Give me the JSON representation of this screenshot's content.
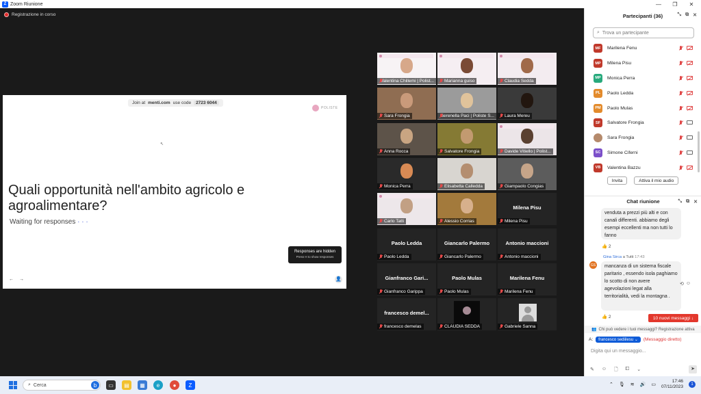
{
  "window": {
    "title": "Zoom Riunione",
    "app_icon": "zoom-logo-icon"
  },
  "recording": {
    "label": "Registrazione in corso"
  },
  "shared_screen": {
    "join_prefix": "Join at",
    "join_site": "menti.com",
    "join_mid": "use code",
    "join_code": "2723 6044",
    "logo_text": "POLISTE",
    "question": "Quali opportunità nell'ambito agricolo e agroalimentare?",
    "status": "Waiting for responses",
    "status_dots": "· · ·",
    "hidden_title": "Responses are hidden",
    "hidden_hint": "Press H to show responses"
  },
  "video_tiles": [
    {
      "name": "Valentina Chillemi | Polist...",
      "type": "video",
      "speaking": true,
      "banner": true,
      "bg": "#f7f3f5",
      "skin": "#d7a88a"
    },
    {
      "name": "Marianna guiso",
      "type": "video",
      "banner": true,
      "bg": "#f5eef2",
      "skin": "#7a4a35"
    },
    {
      "name": "Claudia Sedda",
      "type": "video",
      "banner": true,
      "bg": "#f3ecf0",
      "skin": "#a06a4a"
    },
    {
      "name": "Sara Frongia",
      "type": "video",
      "bg": "#8f6d52",
      "skin": "#c99a7a"
    },
    {
      "name": "Serenella Paci | Poliste S...",
      "type": "video",
      "bg": "#9b9b9b",
      "skin": "#e0c39b"
    },
    {
      "name": "Laura Mereu",
      "type": "video",
      "bg": "#3a3a3a",
      "skin": "#22160f"
    },
    {
      "name": "Anna Rocca",
      "type": "video",
      "bg": "#5d5349",
      "skin": "#c9a582"
    },
    {
      "name": "Salvatore Frongia",
      "type": "video",
      "bg": "#857a34",
      "skin": "#c29a70"
    },
    {
      "name": "Davide Vitiello | Polist...",
      "type": "video",
      "banner": true,
      "bg": "#ece5e8",
      "skin": "#5a4030"
    },
    {
      "name": "Monica Perra",
      "type": "video",
      "bg": "#2a2a2a",
      "skin": "#d88a54"
    },
    {
      "name": "Elisabetta Calledda",
      "type": "video",
      "bg": "#d8d5d0",
      "skin": "#b48e70"
    },
    {
      "name": "Giampaolo Congias",
      "type": "video",
      "bg": "#5c5c5c",
      "skin": "#c6a589"
    },
    {
      "name": "Carlo Tatti",
      "type": "video",
      "banner": true,
      "bg": "#ede7ea",
      "skin": "#c2a084"
    },
    {
      "name": "Alessio Corrias",
      "type": "video",
      "bg": "#a37a3c",
      "skin": "#d7b08c"
    },
    {
      "name": "Milena Pisu",
      "type": "name"
    },
    {
      "name": "Paolo Ledda",
      "type": "name"
    },
    {
      "name": "Giancarlo Palermo",
      "type": "name"
    },
    {
      "name": "Antonio maccioni",
      "type": "name"
    },
    {
      "name": "Gianfranco Garippa",
      "type": "name",
      "big": "Gianfranco  Gari..."
    },
    {
      "name": "Paolo Mulas",
      "type": "name"
    },
    {
      "name": "Marilena Fenu",
      "type": "name"
    },
    {
      "name": "francesco demelas",
      "type": "name",
      "big": "francesco  demel..."
    },
    {
      "name": "CLAUDIA SEDDA",
      "type": "logo"
    },
    {
      "name": "Gabriele Sanna",
      "type": "avatar"
    }
  ],
  "participants_panel": {
    "title": "Partecipanti (36)",
    "search_placeholder": "Trova un partecipante",
    "rows": [
      {
        "initials": "MF",
        "name": "Marilena Fenu",
        "color": "#c0392b",
        "cam": "off"
      },
      {
        "initials": "MP",
        "name": "Milena Pisu",
        "color": "#c0392b",
        "cam": "off"
      },
      {
        "initials": "MP",
        "name": "Monica Perra",
        "color": "#27a97c",
        "cam": "off"
      },
      {
        "initials": "PL",
        "name": "Paolo Ledda",
        "color": "#e38b2c",
        "cam": "off"
      },
      {
        "initials": "PM",
        "name": "Paolo Mulas",
        "color": "#e38b2c",
        "cam": "off"
      },
      {
        "initials": "SF",
        "name": "Salvatore Frongia",
        "color": "#c0392b",
        "cam": "on"
      },
      {
        "initials": "",
        "name": "Sara Frongia",
        "color": "#b58a6c",
        "cam": "on"
      },
      {
        "initials": "SC",
        "name": "Simone Ciferni",
        "color": "#7b4fc9",
        "cam": "on"
      },
      {
        "initials": "VB",
        "name": "Valentina Bazzu",
        "color": "#c0392b",
        "cam": "off"
      }
    ],
    "invite_label": "Invita",
    "unmute_label": "Attiva il mio audio"
  },
  "chat": {
    "title": "Chat riunione",
    "msg1": "venduta a prezzi più alti e con canali differenti. abbiamo degli esempi eccellenti ma non tutti lo fanno",
    "msg1_reaction": "👍 2",
    "msg2_sender": "Gina Sirca",
    "msg2_to": "a Tutti",
    "msg2_time": "17:43",
    "msg2_avatar": "GS",
    "msg2": "mancanza di un sistema fiscale paritario , essendo isola paghiamo lo scotto di non avere agevolazioni legat alla territorialità, vedi la montagna .",
    "msg2_reaction": "👍 2",
    "new_messages": "10 nuovi messaggi ↓",
    "notice": "Chi può vedere i tuoi messaggi? Registrazione attiva",
    "to_label": "A:",
    "recipient": "francesco sediilesu ⌄",
    "direct_label": "(Messaggio diretto)",
    "input_placeholder": "Digita qui un messaggio..."
  },
  "taskbar": {
    "search_label": "Cerca",
    "time": "17:46",
    "date": "07/11/2023",
    "notifications": "1"
  }
}
